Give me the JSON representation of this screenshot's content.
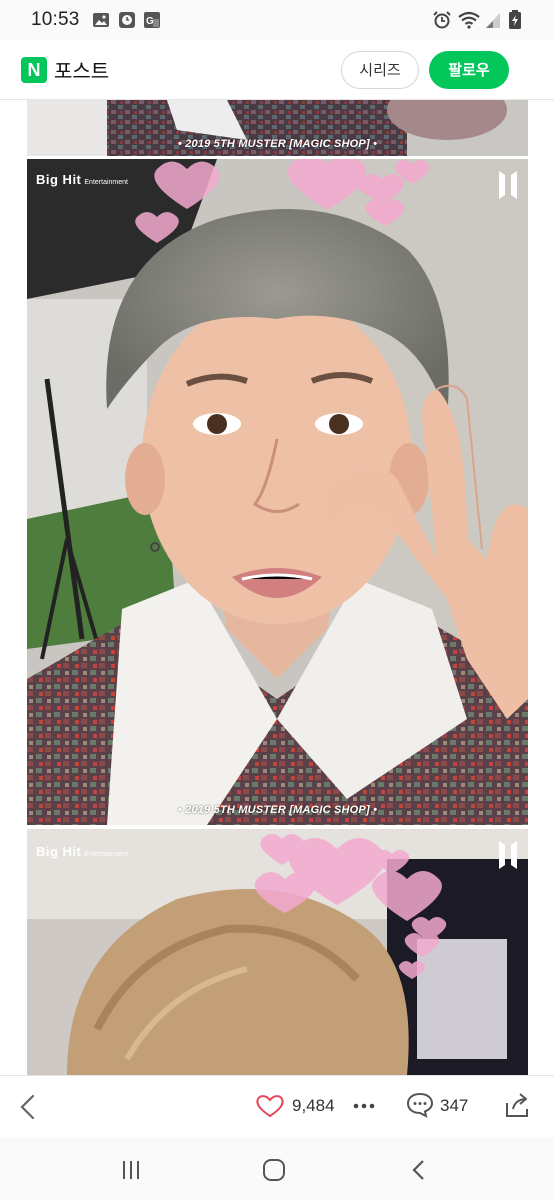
{
  "status_bar": {
    "time": "10:53",
    "left_icons": [
      "gallery-icon",
      "clock-app-icon",
      "translate-app-icon"
    ],
    "right_icons": [
      "alarm-icon",
      "wifi-icon",
      "signal-icon",
      "battery-icon"
    ]
  },
  "header": {
    "logo_letter": "N",
    "title": "포스트",
    "series_label": "시리즈",
    "follow_label": "팔로우",
    "accent_color": "#03c75a"
  },
  "content": {
    "captions": [
      "• 2019 5TH MUSTER [MAGIC SHOP] •",
      "• 2019 5TH MUSTER [MAGIC SHOP] •"
    ],
    "brand_main": "Big Hit",
    "brand_sub": "Entertainment"
  },
  "action_bar": {
    "like_count": "9,484",
    "comment_count": "347",
    "icons": [
      "back-arrow-icon",
      "heart-icon",
      "more-dots-icon",
      "comment-icon",
      "share-icon"
    ]
  },
  "nav_bar": {
    "icons": [
      "recent-apps-icon",
      "home-icon",
      "back-icon"
    ]
  }
}
